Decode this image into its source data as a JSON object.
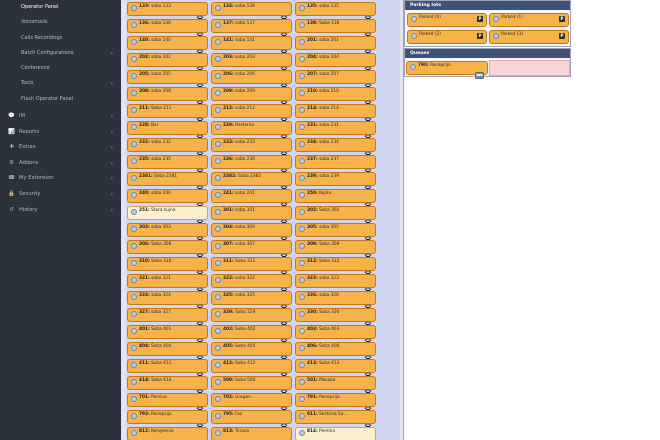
{
  "sidebar": {
    "sub_items": [
      {
        "label": "Operator Panel",
        "active": true,
        "chevron": false
      },
      {
        "label": "Voicemails",
        "active": false,
        "chevron": false
      },
      {
        "label": "Calls Recordings",
        "active": false,
        "chevron": false
      },
      {
        "label": "Batch Configurations",
        "active": false,
        "chevron": true
      },
      {
        "label": "Conference",
        "active": false,
        "chevron": false
      },
      {
        "label": "Tools",
        "active": false,
        "chevron": true
      },
      {
        "label": "Flash Operator Panel",
        "active": false,
        "chevron": false
      }
    ],
    "nav_items": [
      {
        "label": "IM",
        "icon": "chat-icon",
        "glyph": "💬"
      },
      {
        "label": "Reports",
        "icon": "chart-icon",
        "glyph": "📊"
      },
      {
        "label": "Extras",
        "icon": "plus-icon",
        "glyph": "✚"
      },
      {
        "label": "Addons",
        "icon": "cubes-icon",
        "glyph": "⚙"
      },
      {
        "label": "My Extension",
        "icon": "phone-icon",
        "glyph": "☎"
      },
      {
        "label": "Security",
        "icon": "lock-icon",
        "glyph": "🔒"
      },
      {
        "label": "History",
        "icon": "history-icon",
        "glyph": "↺"
      }
    ]
  },
  "extensions": [
    [
      {
        "num": "133:",
        "name": "soba 133"
      },
      {
        "num": "134:",
        "name": "soba 134"
      },
      {
        "num": "135:",
        "name": "soba 135"
      }
    ],
    [
      {
        "num": "136:",
        "name": "soba 136"
      },
      {
        "num": "137:",
        "name": "soba 137"
      },
      {
        "num": "138:",
        "name": "Soba 138"
      }
    ],
    [
      {
        "num": "140:",
        "name": "soba 140"
      },
      {
        "num": "141:",
        "name": "soba 141"
      },
      {
        "num": "201:",
        "name": "soba 201"
      }
    ],
    [
      {
        "num": "202:",
        "name": "soba 202"
      },
      {
        "num": "203:",
        "name": "soba 203"
      },
      {
        "num": "204:",
        "name": "soba 204"
      }
    ],
    [
      {
        "num": "205:",
        "name": "soba 205"
      },
      {
        "num": "206:",
        "name": "soba 206"
      },
      {
        "num": "207:",
        "name": "soba 207"
      }
    ],
    [
      {
        "num": "208:",
        "name": "soba 208"
      },
      {
        "num": "209:",
        "name": "soba 209"
      },
      {
        "num": "210:",
        "name": "soba 210"
      }
    ],
    [
      {
        "num": "211:",
        "name": "Soba 211"
      },
      {
        "num": "212:",
        "name": "soba 212"
      },
      {
        "num": "214:",
        "name": "soba 214"
      }
    ],
    [
      {
        "num": "228:",
        "name": "Bar"
      },
      {
        "num": "229:",
        "name": "Restoran"
      },
      {
        "num": "231:",
        "name": "soba 231"
      }
    ],
    [
      {
        "num": "232:",
        "name": "soba 232"
      },
      {
        "num": "233:",
        "name": "soba 233"
      },
      {
        "num": "234:",
        "name": "soba 234"
      }
    ],
    [
      {
        "num": "235:",
        "name": "soba 235"
      },
      {
        "num": "236:",
        "name": "soba 236"
      },
      {
        "num": "237:",
        "name": "soba 237"
      }
    ],
    [
      {
        "num": "2381:",
        "name": "Soba 2381"
      },
      {
        "num": "2382:",
        "name": "Soba 2382"
      },
      {
        "num": "239:",
        "name": "soba 239"
      }
    ],
    [
      {
        "num": "240:",
        "name": "soba 240"
      },
      {
        "num": "241:",
        "name": "soba 241"
      },
      {
        "num": "250:",
        "name": "Kujna"
      }
    ],
    [
      {
        "num": "251:",
        "name": "Stara kujna",
        "idle": true
      },
      {
        "num": "301:",
        "name": "soba 301"
      },
      {
        "num": "302:",
        "name": "Soba 302"
      }
    ],
    [
      {
        "num": "303:",
        "name": "soba 303"
      },
      {
        "num": "304:",
        "name": "soba 304"
      },
      {
        "num": "305:",
        "name": "soba 305"
      }
    ],
    [
      {
        "num": "306:",
        "name": "Soba 306"
      },
      {
        "num": "307:",
        "name": "soba 307"
      },
      {
        "num": "309:",
        "name": "Soba 309"
      }
    ],
    [
      {
        "num": "310:",
        "name": "Soba 310"
      },
      {
        "num": "311:",
        "name": "Soba 311"
      },
      {
        "num": "312:",
        "name": "Soba 312"
      }
    ],
    [
      {
        "num": "321:",
        "name": "soba 321"
      },
      {
        "num": "322:",
        "name": "soba 322"
      },
      {
        "num": "323:",
        "name": "soba 323"
      }
    ],
    [
      {
        "num": "324:",
        "name": "soba 324"
      },
      {
        "num": "325:",
        "name": "soba 325"
      },
      {
        "num": "326:",
        "name": "soba 326"
      }
    ],
    [
      {
        "num": "327:",
        "name": "soba 327"
      },
      {
        "num": "329:",
        "name": "Soba 329"
      },
      {
        "num": "330:",
        "name": "Soba 330"
      }
    ],
    [
      {
        "num": "401:",
        "name": "Soba 401"
      },
      {
        "num": "402:",
        "name": "Soba 402"
      },
      {
        "num": "403:",
        "name": "Soba 403"
      }
    ],
    [
      {
        "num": "404:",
        "name": "Soba 404"
      },
      {
        "num": "405:",
        "name": "Soba 405"
      },
      {
        "num": "406:",
        "name": "Soba 406"
      }
    ],
    [
      {
        "num": "411:",
        "name": "Soba 411"
      },
      {
        "num": "412:",
        "name": "Soba 412"
      },
      {
        "num": "413:",
        "name": "Soba 413"
      }
    ],
    [
      {
        "num": "414:",
        "name": "Soba 414"
      },
      {
        "num": "500:",
        "name": "Soba 500"
      },
      {
        "num": "501:",
        "name": "Masaza"
      }
    ],
    [
      {
        "num": "701:",
        "name": "Porsina"
      },
      {
        "num": "702:",
        "name": "Gregan"
      },
      {
        "num": "791:",
        "name": "Recepcija"
      }
    ],
    [
      {
        "num": "792:",
        "name": "Recepcija"
      },
      {
        "num": "795:",
        "name": "Fax"
      },
      {
        "num": "811:",
        "name": "Sestrina Sa..."
      }
    ],
    [
      {
        "num": "812:",
        "name": "Kongresna"
      },
      {
        "num": "813:",
        "name": "Terasa"
      },
      {
        "num": "814:",
        "name": "Perelna",
        "idle": true
      }
    ]
  ],
  "parking": {
    "title": "Parking lots",
    "slots": [
      {
        "label": "Parked (0)",
        "badge": "P"
      },
      {
        "label": "Parked (1)",
        "badge": "P"
      },
      {
        "label": "Parked (2)",
        "badge": "P"
      },
      {
        "label": "Parked (3)",
        "badge": "P"
      }
    ]
  },
  "queues": {
    "title": "Queues",
    "items": [
      {
        "num": "790:",
        "name": "Recepcija",
        "icon": "queue-icon"
      }
    ]
  },
  "colors": {
    "sidebar_bg": "#2b323b",
    "ext_busy": "#f7b24a",
    "ext_idle": "#fbefcf",
    "panel_header": "#3f5179",
    "queue_alert": "#fad4d8"
  }
}
